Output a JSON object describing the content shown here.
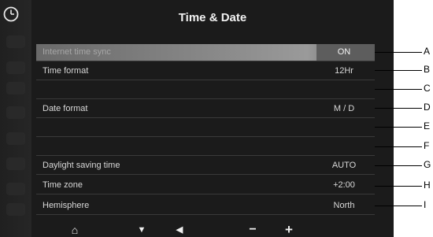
{
  "header": {
    "title": "Time & Date"
  },
  "rows": [
    {
      "label": "Internet time sync",
      "value": "ON"
    },
    {
      "label": "Time format",
      "value": "12Hr"
    },
    {
      "label": "",
      "value": ""
    },
    {
      "label": "Date format",
      "value": "M / D"
    },
    {
      "label": "",
      "value": ""
    },
    {
      "label": "",
      "value": ""
    },
    {
      "label": "Daylight saving time",
      "value": "AUTO"
    },
    {
      "label": "Time zone",
      "value": "+2:00"
    },
    {
      "label": "Hemisphere",
      "value": "North"
    }
  ],
  "callouts": [
    "A",
    "B",
    "C",
    "D",
    "E",
    "F",
    "G",
    "H",
    "I"
  ],
  "bottom_bar": {
    "home": "⌂",
    "down": "▼",
    "left": "◀",
    "minus": "−",
    "plus": "+"
  },
  "colors": {
    "background": "#1b1b1b",
    "selected_row": "#8a8a8a",
    "text": "#d8d8d8"
  }
}
